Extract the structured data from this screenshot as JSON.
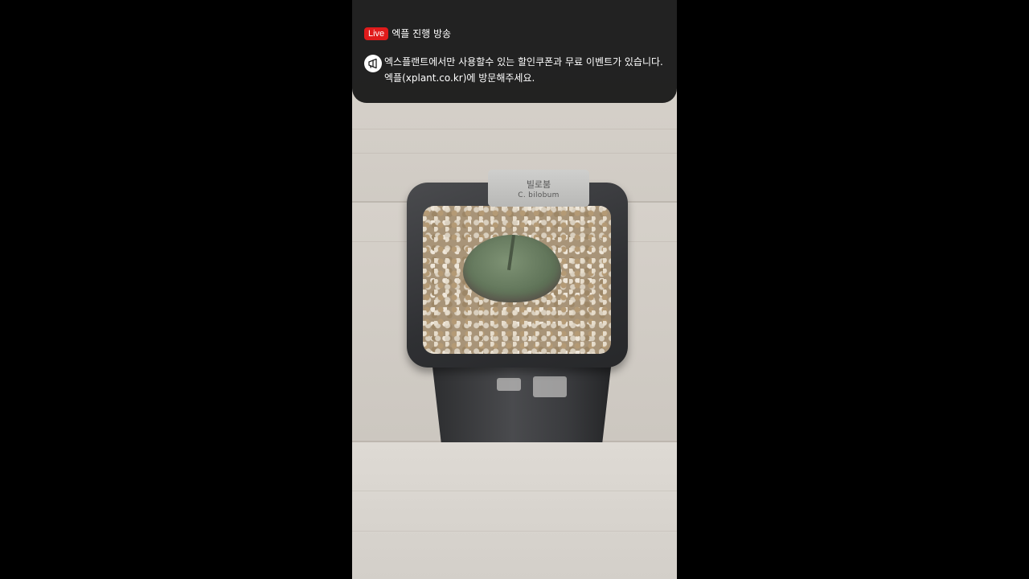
{
  "stream": {
    "live_badge": "Live",
    "title": "엑플 진행 방송"
  },
  "notice": {
    "icon": "megaphone-icon",
    "line1": "엑스플랜트에서만 사용할수 있는 할인쿠폰과 무료 이벤트가 있습니다.",
    "line2": "엑플(xplant.co.kr)에 방문해주세요."
  },
  "plant_label": {
    "korean": "빌로붐",
    "latin": "C. bilobum"
  },
  "colors": {
    "live_badge": "#e01b1b",
    "overlay": "#181818"
  }
}
